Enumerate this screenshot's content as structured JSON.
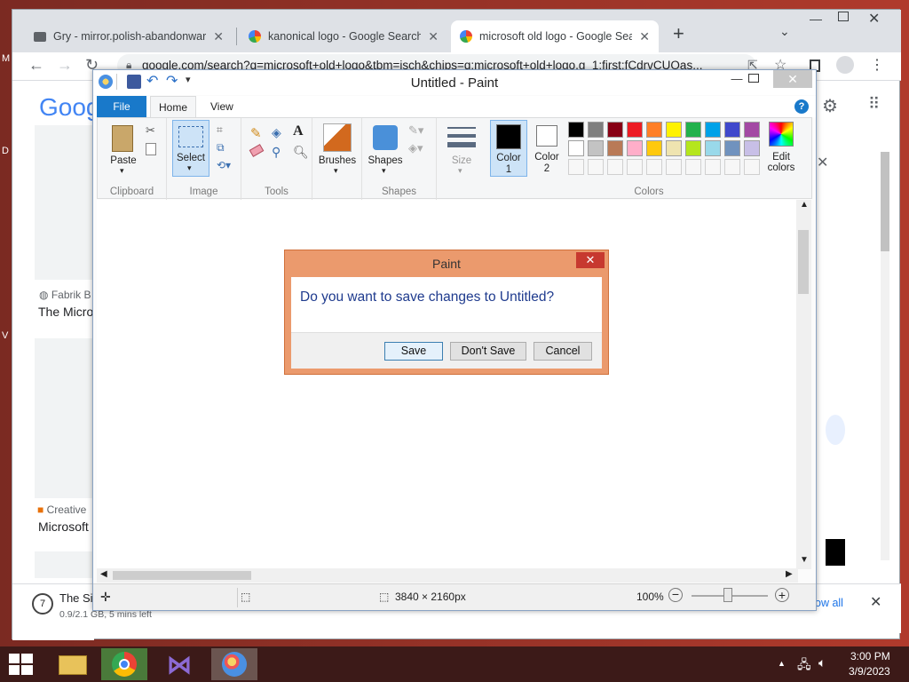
{
  "desktop": {
    "edge_letters": [
      "M",
      "D",
      "V"
    ]
  },
  "browser": {
    "tabs": [
      {
        "title": "Gry - mirror.polish-abandonware",
        "icon": "folder-icon"
      },
      {
        "title": "kanonical logo - Google Search",
        "icon": "google-icon"
      },
      {
        "title": "microsoft old logo - Google Search",
        "icon": "google-icon"
      }
    ],
    "new_tab": "+",
    "url": "google.com/search?q=microsoft+old+logo&tbm=isch&chips=q:microsoft+old+logo,g_1:first:fCdrvCUOas...",
    "page": {
      "logo_partial": "Goog",
      "result1_source": "Fabrik B",
      "result1_title": "The Micro",
      "result2_source": "Creative",
      "result2_title": "Microsoft"
    },
    "download": {
      "name": "The Si",
      "status": "0.9/2.1 GB, 5 mins left",
      "show_all": "ow all"
    }
  },
  "paint": {
    "title": "Untitled - Paint",
    "tabs": {
      "file": "File",
      "home": "Home",
      "view": "View"
    },
    "groups": {
      "clipboard": "Clipboard",
      "image": "Image",
      "tools": "Tools",
      "shapes": "Shapes",
      "colors": "Colors"
    },
    "buttons": {
      "paste": "Paste",
      "select": "Select",
      "brushes": "Brushes",
      "shapes": "Shapes",
      "size": "Size",
      "color1_a": "Color",
      "color1_b": "1",
      "color2_a": "Color",
      "color2_b": "2",
      "edit_colors_a": "Edit",
      "edit_colors_b": "colors"
    },
    "palette_row1": [
      "#000000",
      "#7f7f7f",
      "#880015",
      "#ed1c24",
      "#ff7f27",
      "#fff200",
      "#22b14c",
      "#00a2e8",
      "#3f48cc",
      "#a349a4"
    ],
    "palette_row2": [
      "#ffffff",
      "#c3c3c3",
      "#b97a57",
      "#ffaec9",
      "#ffc90e",
      "#efe4b0",
      "#b5e61d",
      "#99d9ea",
      "#7092be",
      "#c8bfe7"
    ],
    "status": {
      "dimensions": "3840 × 2160px",
      "zoom": "100%"
    }
  },
  "dialog": {
    "title": "Paint",
    "message": "Do you want to save changes to Untitled?",
    "save": "Save",
    "dont_save": "Don't Save",
    "cancel": "Cancel"
  },
  "taskbar": {
    "time": "3:00 PM",
    "date": "3/9/2023"
  }
}
